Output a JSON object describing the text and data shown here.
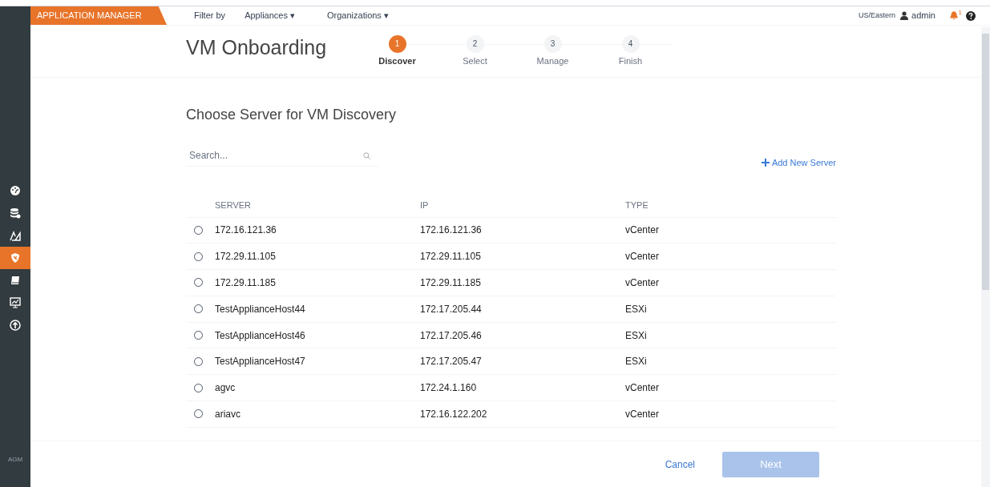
{
  "app": {
    "title": "APPLICATION MANAGER",
    "short_name": "AGM"
  },
  "top_bar": {
    "filter_label": "Filter by",
    "filters": [
      "Appliances ▾",
      "Organizations ▾"
    ],
    "timezone": "US/Eastern",
    "user": "admin",
    "notification_count": "1"
  },
  "side_nav": [
    {
      "selected": false
    },
    {
      "selected": false
    },
    {
      "selected": false
    },
    {
      "selected": true
    },
    {
      "selected": false
    },
    {
      "selected": false
    },
    {
      "selected": false
    }
  ],
  "page_title": "VM Onboarding",
  "steps": [
    {
      "number": "1",
      "label": "Discover",
      "selected": true
    },
    {
      "number": "2",
      "label": "Select",
      "selected": false
    },
    {
      "number": "3",
      "label": "Manage",
      "selected": false
    },
    {
      "number": "4",
      "label": "Finish",
      "selected": false
    }
  ],
  "section_title": "Choose Server for VM Discovery",
  "search": {
    "placeholder": "Search..."
  },
  "add_server": "Add New Server",
  "table": {
    "columns": [
      "SERVER",
      "IP",
      "TYPE"
    ],
    "rows": [
      {
        "server": "172.16.121.36",
        "ip": "172.16.121.36",
        "type": "vCenter",
        "selected": false
      },
      {
        "server": "172.29.11.105",
        "ip": "172.29.11.105",
        "type": "vCenter",
        "selected": false
      },
      {
        "server": "172.29.11.185",
        "ip": "172.29.11.185",
        "type": "vCenter",
        "selected": false
      },
      {
        "server": "TestApplianceHost44",
        "ip": "172.17.205.44",
        "type": "ESXi",
        "selected": false
      },
      {
        "server": "TestApplianceHost46",
        "ip": "172.17.205.46",
        "type": "ESXi",
        "selected": false
      },
      {
        "server": "TestApplianceHost47",
        "ip": "172.17.205.47",
        "type": "ESXi",
        "selected": false
      },
      {
        "server": "agvc",
        "ip": "172.24.1.160",
        "type": "vCenter",
        "selected": false
      },
      {
        "server": "ariavc",
        "ip": "172.16.122.202",
        "type": "vCenter",
        "selected": false
      }
    ]
  },
  "buttons": {
    "cancel": "Cancel",
    "next": {
      "label": "Next",
      "disabled": true
    }
  }
}
